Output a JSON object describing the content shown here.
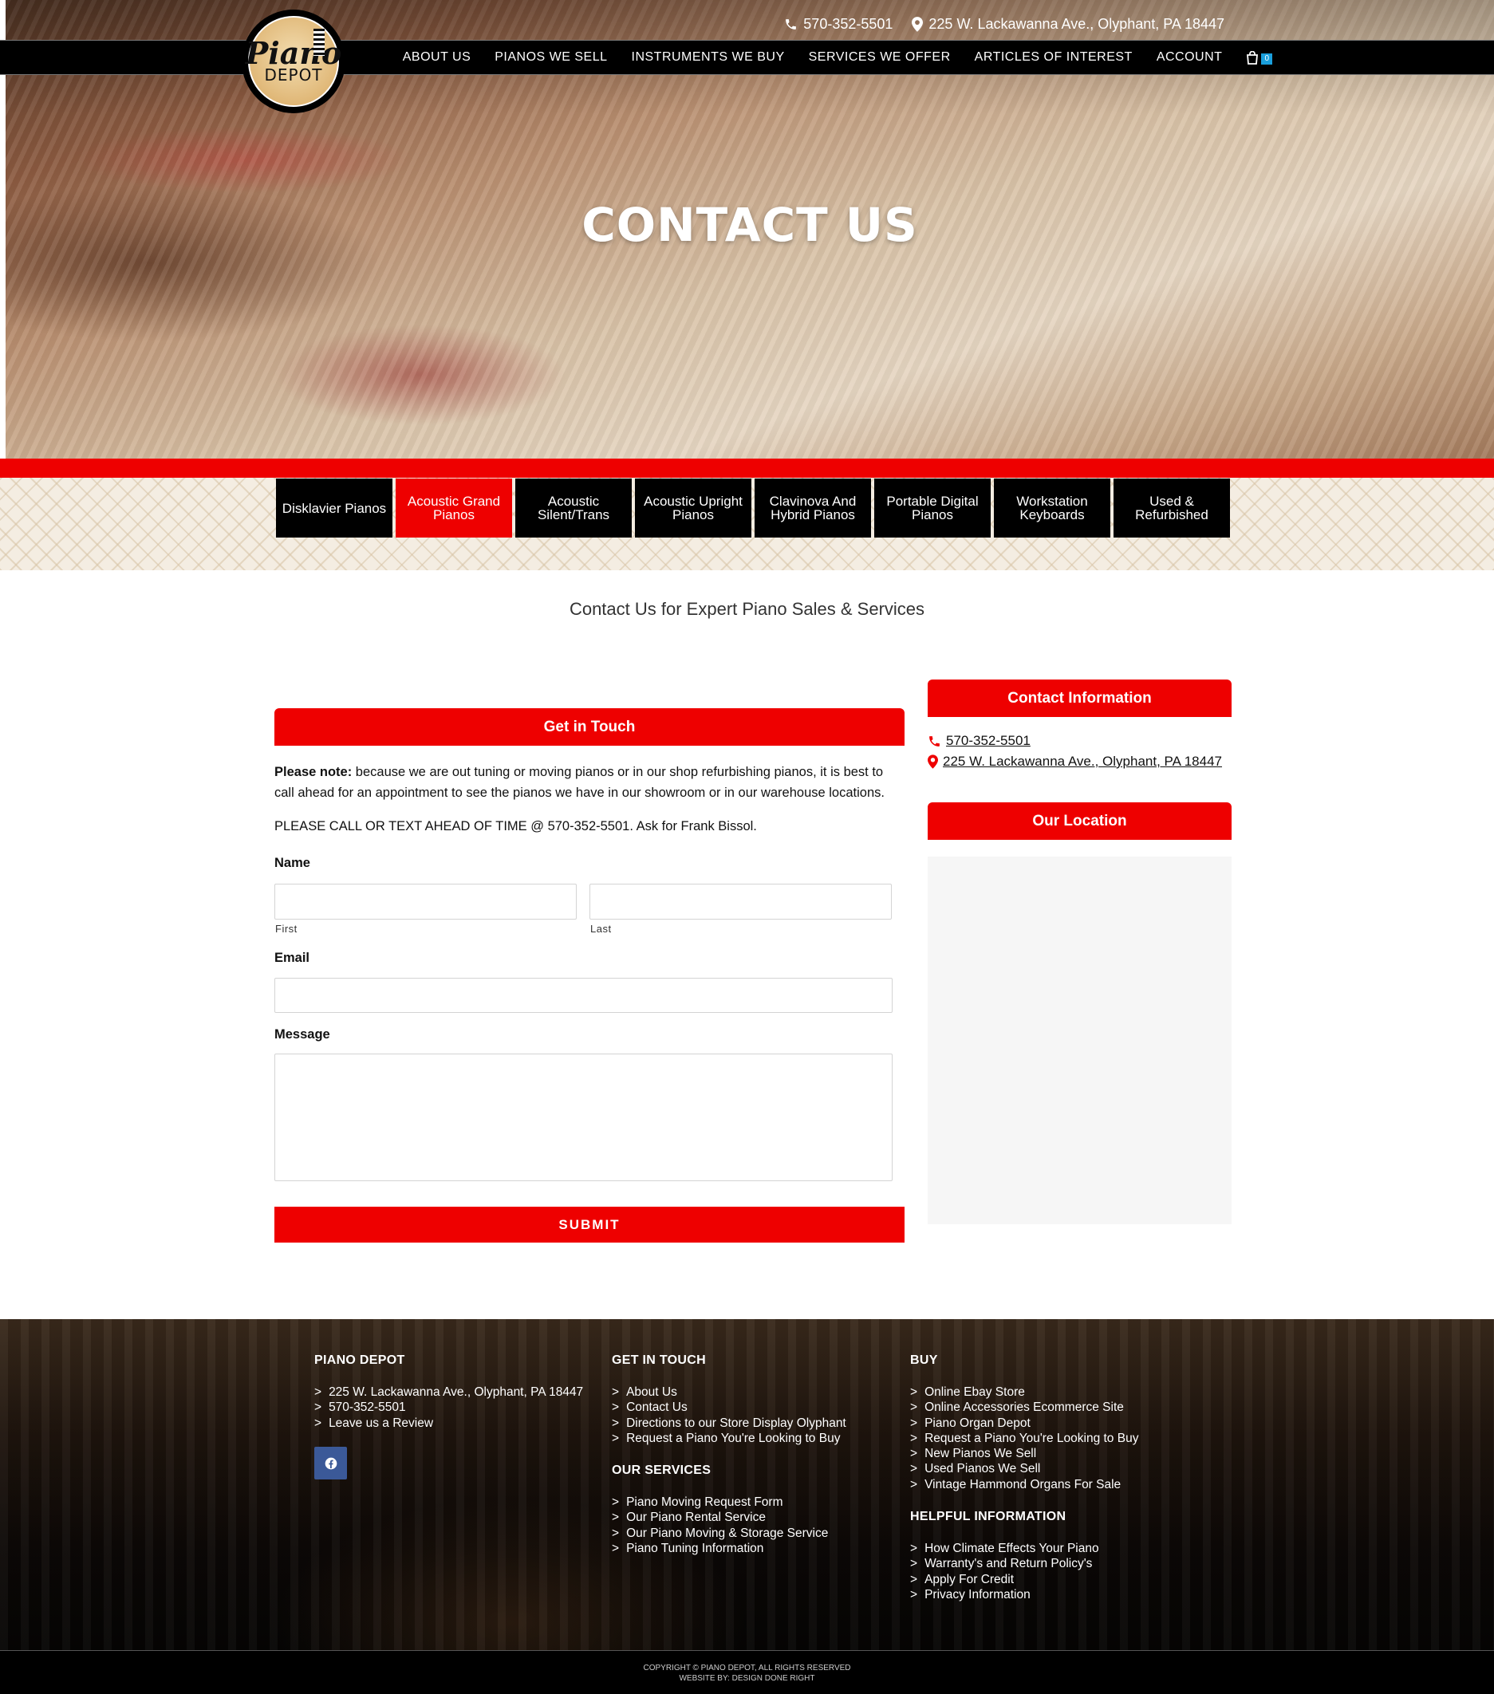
{
  "header": {
    "phone": "570-352-5501",
    "address": "225 W. Lackawanna Ave., Olyphant, PA 18447",
    "logo": {
      "line1": "Piano",
      "line2": "DEPOT"
    },
    "nav": [
      "ABOUT US",
      "PIANOS WE SELL",
      "INSTRUMENTS WE BUY",
      "SERVICES WE OFFER",
      "ARTICLES OF INTEREST",
      "ACCOUNT"
    ],
    "cart_count": "0",
    "icons": {
      "phone": "phone-icon",
      "address": "map-marker-icon",
      "cart": "shopping-bag-icon"
    }
  },
  "hero": {
    "title": "CONTACT US"
  },
  "categories": [
    {
      "label": "Disklavier Pianos",
      "active": false
    },
    {
      "label": "Acoustic Grand Pianos",
      "active": true
    },
    {
      "label": "Acoustic Silent/Trans",
      "active": false
    },
    {
      "label": "Acoustic Upright Pianos",
      "active": false
    },
    {
      "label": "Clavinova And Hybrid Pianos",
      "active": false
    },
    {
      "label": "Portable Digital Pianos",
      "active": false
    },
    {
      "label": "Workstation Keyboards",
      "active": false
    },
    {
      "label": "Used & Refurbished",
      "active": false
    }
  ],
  "main": {
    "subtitle": "Contact Us for Expert Piano Sales & Services",
    "form": {
      "heading": "Get in Touch",
      "note_bold": "Please note:",
      "note_text": " because we are out tuning or moving pianos or in our shop refurbishing pianos, it is best to call ahead for an appointment to see the pianos we have in our showroom or in our warehouse locations.",
      "callout": "PLEASE CALL OR TEXT AHEAD OF TIME @ 570-352-5501. Ask for Frank Bissol.",
      "name_label": "Name",
      "first_label": "First",
      "last_label": "Last",
      "first_value": "",
      "last_value": "",
      "email_label": "Email",
      "email_value": "",
      "message_label": "Message",
      "message_value": "",
      "submit_label": "SUBMIT"
    },
    "sidebar": {
      "contact_heading": "Contact Information",
      "phone": "570-352-5501",
      "address": "225 W. Lackawanna Ave., Olyphant, PA 18447",
      "location_heading": "Our Location"
    }
  },
  "footer": {
    "col1": {
      "heading": "PIANO DEPOT",
      "items": [
        "225 W. Lackawanna Ave., Olyphant, PA 18447",
        "570-352-5501",
        "Leave us a Review"
      ],
      "social_icon": "facebook-icon"
    },
    "col2": {
      "heading": "GET IN TOUCH",
      "items": [
        "About Us",
        "Contact Us",
        "Directions to our Store Display Olyphant",
        "Request a Piano You're Looking to Buy"
      ],
      "heading2": "OUR SERVICES",
      "items2": [
        "Piano Moving Request Form",
        "Our Piano Rental Service",
        "Our Piano Moving & Storage Service",
        "Piano Tuning Information"
      ]
    },
    "col3": {
      "heading": "BUY",
      "items": [
        "Online Ebay Store",
        "Online Accessories Ecommerce Site",
        "Piano Organ Depot",
        "Request a Piano You're Looking to Buy",
        "New Pianos We Sell",
        "Used Pianos We Sell",
        "Vintage Hammond Organs For Sale"
      ],
      "heading2": "HELPFUL INFORMATION",
      "items2": [
        "How Climate Effects Your Piano",
        "Warranty's and Return Policy's",
        "Apply For Credit",
        "Privacy Information"
      ]
    },
    "copyright": "COPYRIGHT © PIANO DEPOT, ALL RIGHTS RESERVED",
    "credit": "WEBSITE BY: DESIGN DONE RIGHT"
  },
  "colors": {
    "accent": "#ee0000",
    "nav_bg": "#000000",
    "cart_badge": "#1a9fdc",
    "facebook": "#3b5998"
  }
}
